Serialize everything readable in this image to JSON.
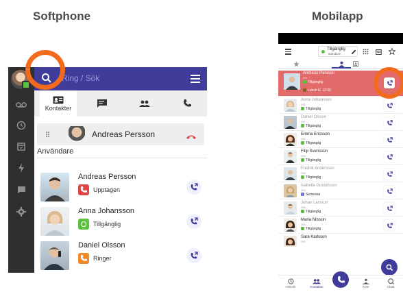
{
  "headings": {
    "softphone": "Softphone",
    "mobileapp": "Mobilapp"
  },
  "softphone": {
    "search_placeholder": "Ring / Sök",
    "tabs": [
      {
        "label": "Kontakter",
        "icon": "contacts-icon"
      },
      {
        "label": "",
        "icon": "chat-icon"
      },
      {
        "label": "",
        "icon": "group-icon"
      },
      {
        "label": "",
        "icon": "phone-icon"
      }
    ],
    "rail_icons": [
      "voicemail-icon",
      "history-icon",
      "calendar-icon",
      "flash-icon",
      "message-icon",
      "settings-icon"
    ],
    "active_call": {
      "name": "Andreas Persson"
    },
    "section_title": "Användare",
    "users": [
      {
        "name": "Andreas Persson",
        "status": "Upptagen",
        "status_color": "#e04848",
        "status_icon": "phone-busy-icon"
      },
      {
        "name": "Anna Johansson",
        "status": "Tillgänglig",
        "status_color": "#5cc13f",
        "status_icon": "available-icon"
      },
      {
        "name": "Daniel  Olsson",
        "status": "Ringer",
        "status_color": "#f08a24",
        "status_icon": "phone-ringing-icon"
      }
    ],
    "colors": {
      "header": "#3f3d99",
      "rail": "#2f2f2f",
      "highlight": "#f26a1b"
    }
  },
  "mobileapp": {
    "state": {
      "title": "Tillgänglig",
      "subtitle": "standard"
    },
    "contacts": [
      {
        "name": "Andreas Persson",
        "ext": "291",
        "status": "Tillgänglig",
        "status_color": "#5cc13f",
        "extra": "Lunch kl. 12:00",
        "active": true
      },
      {
        "name": "Anna Johansson",
        "ext": "292",
        "status": "Tillgänglig",
        "status_color": "#5cc13f"
      },
      {
        "name": "Daniel  Olsson",
        "ext": "297",
        "status": "Tillgänglig",
        "status_color": "#5cc13f"
      },
      {
        "name": "Emma Ericsson",
        "ext": "295",
        "status": "Tillgänglig",
        "status_color": "#5cc13f"
      },
      {
        "name": "Filip Svensson",
        "ext": "299",
        "status": "Tillgänglig",
        "status_color": "#5cc13f"
      },
      {
        "name": "Fredrik Andersson",
        "ext": "298",
        "status": "Tillgänglig",
        "status_color": "#5cc13f"
      },
      {
        "name": "Isabella Gustafsson",
        "ext": "300",
        "status": "Semester",
        "status_color": "#7b6fd4"
      },
      {
        "name": "Johan Larsson",
        "ext": "296",
        "status": "Tillgänglig",
        "status_color": "#5cc13f"
      },
      {
        "name": "Maria Nilsson",
        "ext": "294",
        "status": "Tillgänglig",
        "status_color": "#5cc13f"
      },
      {
        "name": "Sara  Karlsson",
        "ext": "293",
        "status": "",
        "status_color": "#5cc13f"
      }
    ],
    "bottom_nav": [
      {
        "label": "Historik",
        "icon": "history-icon"
      },
      {
        "label": "Kontakter",
        "icon": "contacts-icon",
        "active": true
      },
      {
        "label": "Köer",
        "icon": "queue-icon"
      },
      {
        "label": "Chatt",
        "icon": "chat-icon"
      }
    ],
    "colors": {
      "active_row": "#e36a6a",
      "primary": "#3f3d99"
    }
  }
}
